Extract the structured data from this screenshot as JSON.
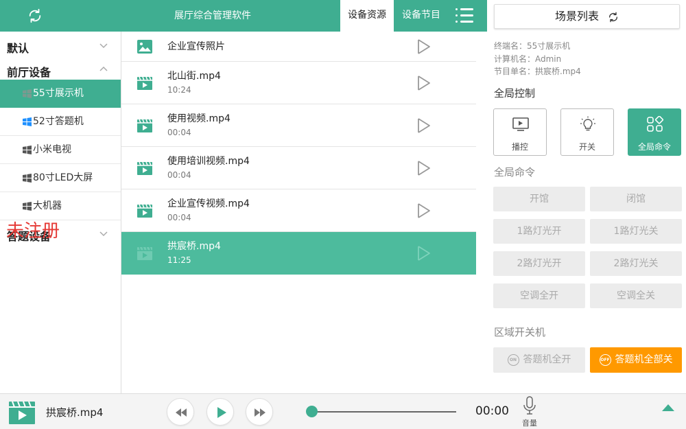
{
  "colors": {
    "primary": "#3fae91",
    "selected_row": "#4dbb9d",
    "accent_orange": "#ff9900",
    "warning_red": "#e53935"
  },
  "header": {
    "title": "展厅综合管理软件",
    "tabs": [
      {
        "label": "设备资源",
        "active": true
      },
      {
        "label": "设备节目",
        "active": false
      }
    ],
    "refresh_icon": "refresh-icon",
    "menu_icon": "list-menu-icon"
  },
  "sidebar": {
    "groups": [
      {
        "label": "默认",
        "expanded": false
      },
      {
        "label": "前厅设备",
        "expanded": true,
        "devices": [
          {
            "label": "55寸展示机",
            "active": true
          },
          {
            "label": "52寸答题机",
            "active": false
          },
          {
            "label": "小米电视",
            "active": false
          },
          {
            "label": "80寸LED大屏",
            "active": false
          },
          {
            "label": "大机器",
            "active": false
          }
        ]
      },
      {
        "label": "答题设备",
        "expanded": false
      }
    ],
    "unregistered_label": "未注册"
  },
  "resources": [
    {
      "name": "企业宣传照片",
      "duration": "",
      "type": "image"
    },
    {
      "name": "北山街.mp4",
      "duration": "10:24",
      "type": "video"
    },
    {
      "name": "使用视频.mp4",
      "duration": "00:04",
      "type": "video"
    },
    {
      "name": "使用培训视频.mp4",
      "duration": "00:04",
      "type": "video"
    },
    {
      "name": "企业宣传视频.mp4",
      "duration": "00:04",
      "type": "video"
    },
    {
      "name": "拱宸桥.mp4",
      "duration": "11:25",
      "type": "video",
      "selected": true
    }
  ],
  "right_panel": {
    "scene_button": "场景列表",
    "info": {
      "terminal": "终端名：55寸展示机",
      "computer": "计算机名：Admin",
      "program": "节目单名：拱宸桥.mp4"
    },
    "global_control_title": "全局控制",
    "controls": [
      {
        "label": "播控",
        "icon": "monitor-play-icon",
        "active": false
      },
      {
        "label": "开关",
        "icon": "light-bulb-icon",
        "active": false
      },
      {
        "label": "全局命令",
        "icon": "grid-apps-icon",
        "active": true
      }
    ],
    "global_commands_title": "全局命令",
    "commands": [
      "开馆",
      "闭馆",
      "1路灯光开",
      "1路灯光关",
      "2路灯光开",
      "2路灯光关",
      "空调全开",
      "空调全关"
    ],
    "zone_title": "区域开关机",
    "zone_buttons": [
      {
        "label": "答题机全开",
        "badge": "ON"
      },
      {
        "label": "答题机全部关",
        "badge": "OFF"
      }
    ]
  },
  "player": {
    "title": "拱宸桥.mp4",
    "time": "00:00",
    "progress": 0,
    "volume_label": "音量"
  }
}
